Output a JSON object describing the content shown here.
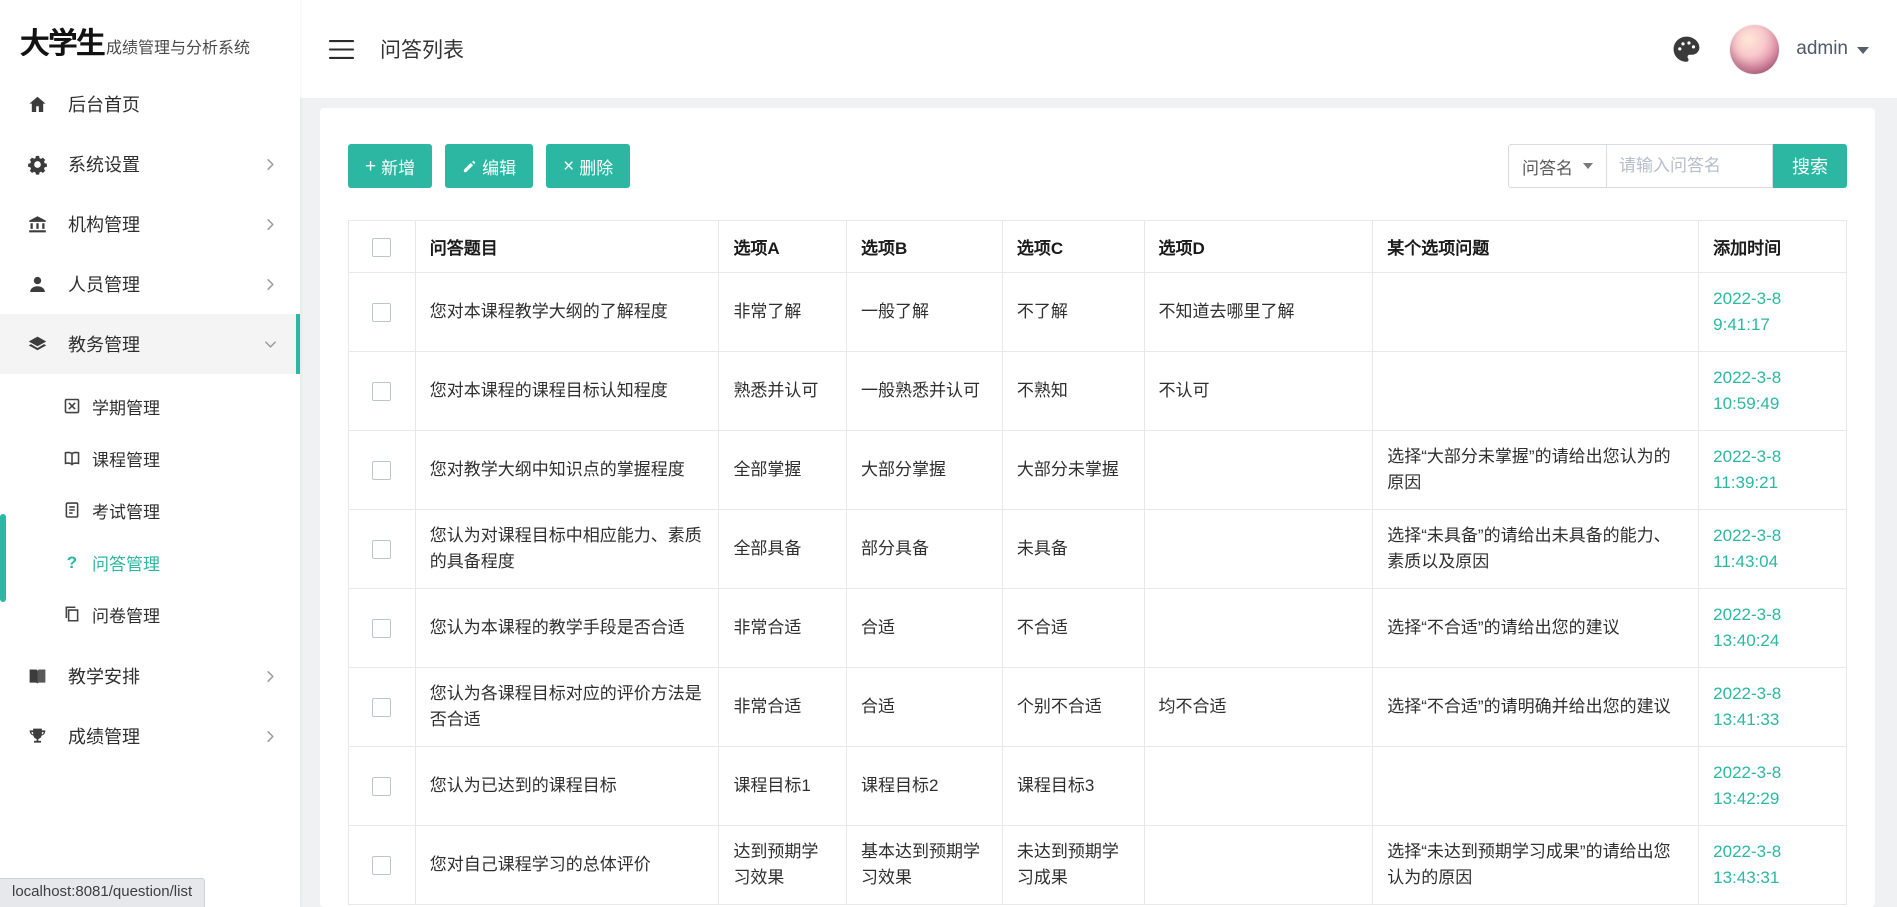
{
  "app": {
    "logo_primary": "大学生",
    "logo_secondary": "成绩管理与分析系统"
  },
  "header": {
    "title": "问答列表",
    "username": "admin"
  },
  "sidebar": {
    "items": [
      {
        "key": "home",
        "label": "后台首页",
        "icon": "home-icon",
        "expandable": false
      },
      {
        "key": "system-settings",
        "label": "系统设置",
        "icon": "gear-icon",
        "expandable": true
      },
      {
        "key": "organization",
        "label": "机构管理",
        "icon": "bank-icon",
        "expandable": true
      },
      {
        "key": "personnel",
        "label": "人员管理",
        "icon": "user-icon",
        "expandable": true
      },
      {
        "key": "academic",
        "label": "教务管理",
        "icon": "layers-icon",
        "expandable": true,
        "expanded": true,
        "children": [
          {
            "key": "semester",
            "label": "学期管理",
            "icon": "semester-icon"
          },
          {
            "key": "course",
            "label": "课程管理",
            "icon": "course-icon"
          },
          {
            "key": "exam",
            "label": "考试管理",
            "icon": "exam-icon"
          },
          {
            "key": "qa",
            "label": "问答管理",
            "icon": "question-icon",
            "active": true
          },
          {
            "key": "survey",
            "label": "问卷管理",
            "icon": "survey-icon"
          }
        ]
      },
      {
        "key": "teaching-schedule",
        "label": "教学安排",
        "icon": "book-icon",
        "expandable": true
      },
      {
        "key": "grade",
        "label": "成绩管理",
        "icon": "trophy-icon",
        "expandable": true
      }
    ]
  },
  "toolbar": {
    "buttons": [
      {
        "name": "add-button",
        "icon": "plus-icon",
        "label": "新增"
      },
      {
        "name": "edit-button",
        "icon": "pencil-icon",
        "label": "编辑"
      },
      {
        "name": "delete-button",
        "icon": "close-icon",
        "label": "删除"
      }
    ],
    "filter_field_label": "问答名",
    "search_placeholder": "请输入问答名",
    "search_label": "搜索"
  },
  "table": {
    "columns": [
      "问答题目",
      "选项A",
      "选项B",
      "选项C",
      "选项D",
      "某个选项问题",
      "添加时间"
    ],
    "rows": [
      {
        "question": "您对本课程教学大纲的了解程度",
        "option_a": "非常了解",
        "option_b": "一般了解",
        "option_c": "不了解",
        "option_d": "不知道去哪里了解",
        "extra_question": "",
        "date": "2022-3-8",
        "time": "9:41:17"
      },
      {
        "question": "您对本课程的课程目标认知程度",
        "option_a": "熟悉并认可",
        "option_b": "一般熟悉并认可",
        "option_c": "不熟知",
        "option_d": "不认可",
        "extra_question": "",
        "date": "2022-3-8",
        "time": "10:59:49"
      },
      {
        "question": "您对教学大纲中知识点的掌握程度",
        "option_a": "全部掌握",
        "option_b": "大部分掌握",
        "option_c": "大部分未掌握",
        "option_d": "",
        "extra_question": "选择“大部分未掌握”的请给出您认为的原因",
        "date": "2022-3-8",
        "time": "11:39:21"
      },
      {
        "question": "您认为对课程目标中相应能力、素质的具备程度",
        "option_a": "全部具备",
        "option_b": "部分具备",
        "option_c": "未具备",
        "option_d": "",
        "extra_question": "选择“未具备”的请给出未具备的能力、素质以及原因",
        "date": "2022-3-8",
        "time": "11:43:04"
      },
      {
        "question": "您认为本课程的教学手段是否合适",
        "option_a": "非常合适",
        "option_b": "合适",
        "option_c": "不合适",
        "option_d": "",
        "extra_question": "选择“不合适”的请给出您的建议",
        "date": "2022-3-8",
        "time": "13:40:24"
      },
      {
        "question": "您认为各课程目标对应的评价方法是否合适",
        "option_a": "非常合适",
        "option_b": "合适",
        "option_c": "个别不合适",
        "option_d": "均不合适",
        "extra_question": "选择“不合适”的请明确并给出您的建议",
        "date": "2022-3-8",
        "time": "13:41:33"
      },
      {
        "question": "您认为已达到的课程目标",
        "option_a": "课程目标1",
        "option_b": "课程目标2",
        "option_c": "课程目标3",
        "option_d": "",
        "extra_question": "",
        "date": "2022-3-8",
        "time": "13:42:29"
      },
      {
        "question": "您对自己课程学习的总体评价",
        "option_a": "达到预期学习效果",
        "option_b": "基本达到预期学习效果",
        "option_c": "未达到预期学习成果",
        "option_d": "",
        "extra_question": "选择“未达到预期学习成果”的请给出您认为的原因",
        "date": "2022-3-8",
        "time": "13:43:31"
      }
    ]
  },
  "status_bar": {
    "text": "localhost:8081/question/list"
  },
  "colors": {
    "accent": "#2bb7a2"
  }
}
